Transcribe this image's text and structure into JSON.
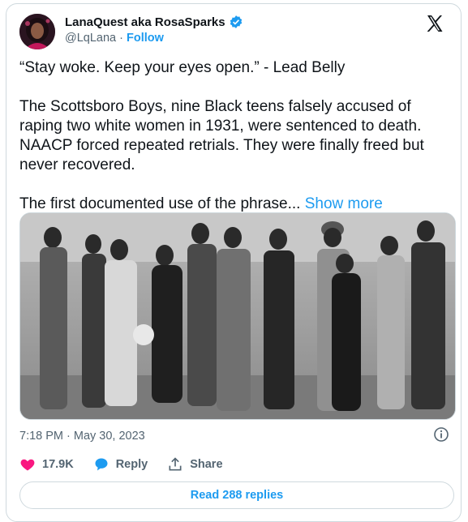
{
  "author": {
    "name": "LanaQuest aka RosaSparks",
    "handle": "@LqLana",
    "separator": "·",
    "follow_label": "Follow"
  },
  "tweet": {
    "paragraphs": [
      "“Stay woke. Keep your eyes open.” - Lead Belly",
      "The Scottsboro Boys, nine Black teens falsely accused of raping two white women in 1931, were sentenced to death. NAACP forced repeated retrials. They were finally freed but never recovered.",
      "The first documented use of the phrase... "
    ],
    "show_more_label": "Show more"
  },
  "meta": {
    "timestamp": "7:18 PM · May 30, 2023"
  },
  "actions": {
    "likes": "17.9K",
    "reply_label": "Reply",
    "share_label": "Share"
  },
  "read_replies_label": "Read 288 replies",
  "colors": {
    "accent": "#1d9bf0",
    "like": "#f91880",
    "muted": "#536471",
    "border": "#cfd9de"
  },
  "icons": [
    "verified-badge-icon",
    "x-logo-icon",
    "info-icon",
    "heart-icon",
    "reply-icon",
    "share-icon"
  ]
}
